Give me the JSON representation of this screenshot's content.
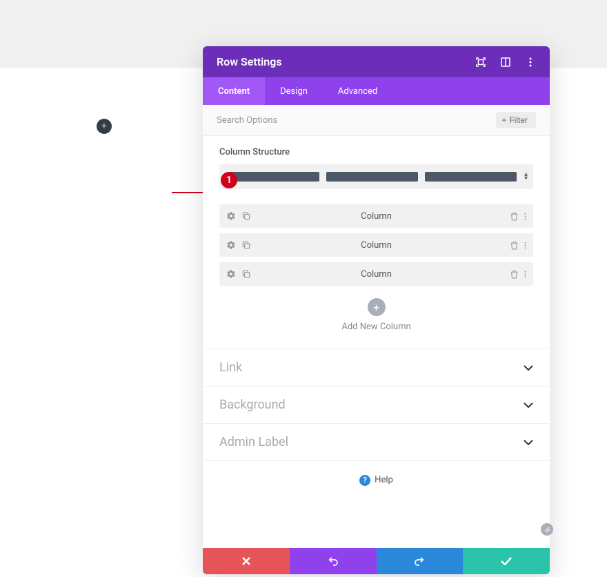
{
  "annotation": {
    "badge_number": "1"
  },
  "modal": {
    "title": "Row Settings",
    "tabs": [
      {
        "label": "Content",
        "active": true
      },
      {
        "label": "Design",
        "active": false
      },
      {
        "label": "Advanced",
        "active": false
      }
    ],
    "search_placeholder": "Search Options",
    "filter_label": "Filter",
    "column_structure_label": "Column Structure",
    "columns": [
      {
        "label": "Column"
      },
      {
        "label": "Column"
      },
      {
        "label": "Column"
      }
    ],
    "add_column_label": "Add New Column",
    "accordions": [
      {
        "title": "Link"
      },
      {
        "title": "Background"
      },
      {
        "title": "Admin Label"
      }
    ],
    "help_label": "Help"
  }
}
